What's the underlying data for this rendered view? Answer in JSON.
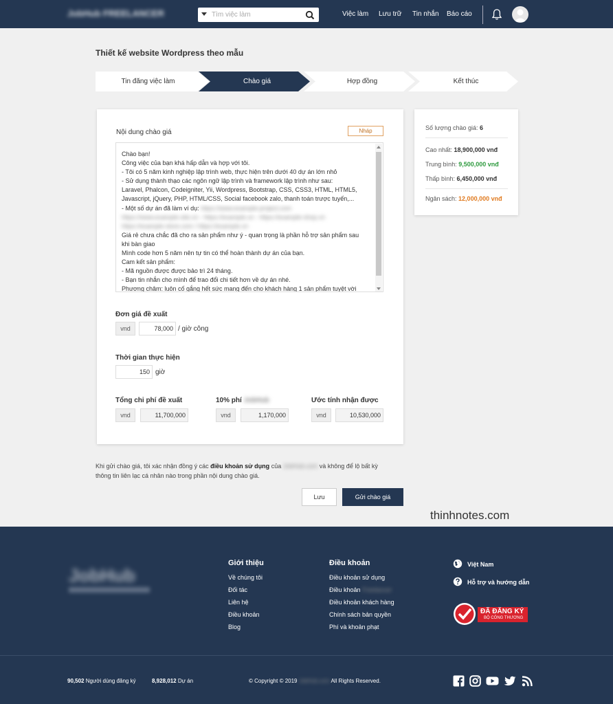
{
  "header": {
    "search_placeholder": "Tìm việc làm",
    "nav": [
      "Việc làm",
      "Lưu trữ",
      "Tin nhắn",
      "Báo cáo"
    ],
    "logo": "JobHub FREELANCER"
  },
  "page": {
    "title": "Thiết kế website Wordpress theo mẫu",
    "steps": [
      "Tin đăng việc làm",
      "Chào giá",
      "Hợp đồng",
      "Kết thúc"
    ],
    "active_step": "Chào giá"
  },
  "proposal": {
    "content_label": "Nội dung chào giá",
    "draft_label": "Nháp",
    "lines": [
      "Chào bạn!",
      "Công việc của bạn khá hấp dẫn và hợp với tôi.",
      "- Tôi có 5 năm kinh nghiệp lập trình web, thực hiện trên dưới 40 dự án lớn nhỏ",
      "- Sử dụng thành thạo các ngôn ngữ lập trình và framework lập trình như sau:",
      "Laravel, Phalcon, Codeigniter, Yii, Wordpress, Bootstrap, CSS, CSS3, HTML, HTML5,",
      "Javascript, jQuery, PHP, HTML/CSS, Social facebook zalo, thanh toán trược tuyến,...",
      "- Một số dự án đã làm ví dụ:",
      "",
      "",
      "Giá rẻ chưa chắc đã cho ra sản phẩm như ý - quan trọng là phần hỗ trợ sản phẩm sau",
      "khi bàn giao",
      "Mình code hơn 5 năm nên tự tin có thể hoàn thành dự án của bạn.",
      "Cam kết sản phẩm:",
      "- Mã nguồn được được bảo trì 24 tháng.",
      "- Bạn tin nhắn cho mình để trao đổi chi tiết hơn về dự án nhé.",
      "Phương châm: luôn cố gắng hết sức mang đến cho khách hàng 1 sản phẩm tuyệt vời"
    ],
    "unit_price_label": "Đơn giá đề xuất",
    "currency": "vnd",
    "unit_price": "78,000",
    "unit_suffix": "/ giờ công",
    "duration_label": "Thời gian thực hiện",
    "duration": "150",
    "duration_unit": "giờ",
    "total_label": "Tổng chi phí đề xuất",
    "total": "11,700,000",
    "fee_label": "10% phí",
    "fee": "1,170,000",
    "receive_label": "Ước tính nhận được",
    "receive": "10,530,000"
  },
  "summary": {
    "count_label": "Số lượng chào giá:",
    "count": "6",
    "high_label": "Cao nhất:",
    "high": "18,900,000 vnđ",
    "avg_label": "Trung bình:",
    "avg": "9,500,000 vnđ",
    "low_label": "Thấp bình:",
    "low": "6,450,000 vnđ",
    "budget_label": "Ngân sách:",
    "budget": "12,000,000 vnđ",
    "avg_color": "#2e9a3e",
    "budget_color": "#e07a1f"
  },
  "agreement": {
    "p1": "Khi gửi chào giá, tôi xác nhận đồng ý các",
    "terms": "điều khoản sử dụng",
    "p2": "của",
    "p3": "và không để lộ bất kỳ",
    "p4": "thông tin liên lạc cá nhân nào trong phần nội dung chào giá."
  },
  "actions": {
    "save": "Lưu",
    "send": "Gửi chào giá"
  },
  "watermark": "thinhnotes.com",
  "footer": {
    "logo": "JobHub",
    "col1_title": "Giới thiệu",
    "col1": [
      "Về chúng tôi",
      "Đối tác",
      "Liên hệ",
      "Điều khoản",
      "Blog"
    ],
    "col2_title": "Điều khoản",
    "col2": [
      "Điều khoản sử dụng",
      "Điều khoản",
      "Điều khoản khách hàng",
      "Chính sách bản quyền",
      "Phí và khoản phạt"
    ],
    "lang": "Việt Nam",
    "help": "Hỗ trợ và hướng dẫn",
    "badge_main": "ĐÃ ĐĂNG KÝ",
    "badge_sub": "BỘ CÔNG THƯƠNG",
    "users_count": "90,502",
    "users_label": "Người dùng đăng ký",
    "projects_count": "8,928,012",
    "projects_label": "Dự án",
    "copyright_pre": "© Copyright © 2019",
    "copyright_post": "All Rights Reserved."
  }
}
